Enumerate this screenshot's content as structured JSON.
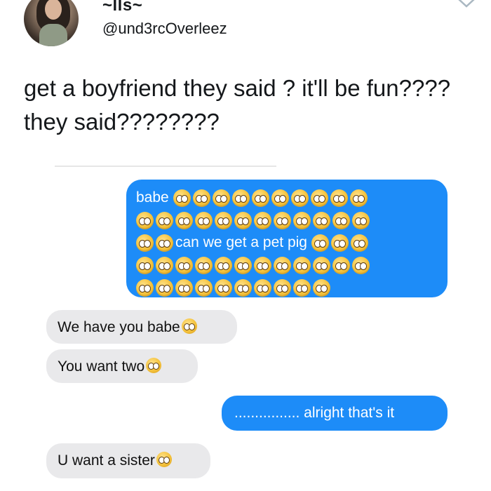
{
  "tweet": {
    "display_name": "~lls~",
    "handle": "@und3rcOverleez",
    "text": "get a boyfriend they said ? it'll be fun???? they said????????",
    "menu_icon": "chevron-down-icon",
    "avatar_icon": "profile-photo"
  },
  "conversation": {
    "emoji_name": "pleading-face-emoji",
    "blue_color": "#1d8cf8",
    "gray_color": "#e9e9eb",
    "messages": [
      {
        "side": "sent",
        "lines": [
          {
            "text": "babe",
            "emoji_after": 10
          },
          {
            "text": "",
            "emoji_after": 12
          },
          {
            "emoji_before": 2,
            "text": "can we get a pet pig",
            "emoji_after": 3
          },
          {
            "text": "",
            "emoji_after": 12
          },
          {
            "text": "",
            "emoji_after": 10
          }
        ]
      },
      {
        "side": "received",
        "text": "We have you babe",
        "emoji_count": 1
      },
      {
        "side": "received",
        "text": "You want two",
        "emoji_count": 1
      },
      {
        "side": "sent",
        "text": "................ alright that's it"
      },
      {
        "side": "received",
        "text": "U want a sister",
        "emoji_count": 1
      }
    ]
  }
}
